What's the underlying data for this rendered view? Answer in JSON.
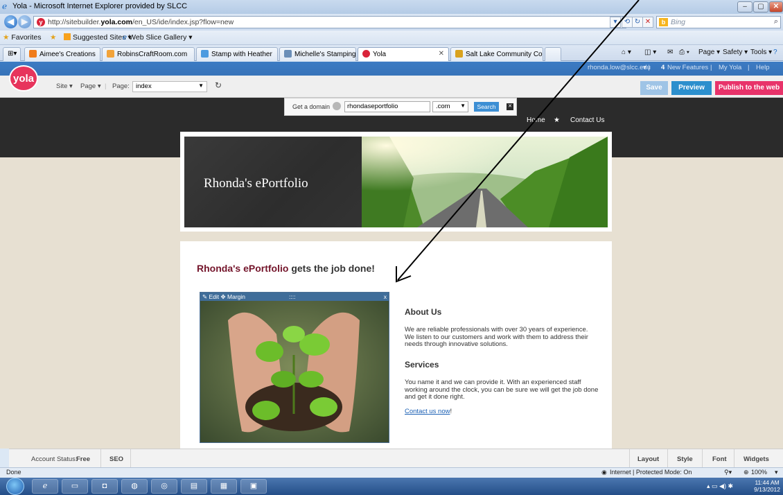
{
  "window": {
    "title": "Yola - Microsoft Internet Explorer provided by SLCC",
    "url_prefix": "http://sitebuilder.",
    "url_domain": "yola.com",
    "url_rest": "/en_US/ide/index.jsp?flow=new",
    "search_placeholder": "Bing"
  },
  "favorites_bar": {
    "favorites": "Favorites",
    "suggested": "Suggested Sites ▾",
    "web_slice": "Web Slice Gallery ▾"
  },
  "tabs": [
    {
      "label": "Aimee's Creations",
      "color": "#f07c1c"
    },
    {
      "label": "RobinsCraftRoom.com",
      "color": "#f2a33a"
    },
    {
      "label": "Stamp with Heather",
      "color": "#4d9be0"
    },
    {
      "label": "Michelle's Stamping Blog",
      "color": "#6b8fb8"
    },
    {
      "label": "Yola",
      "color": "#d9243a"
    },
    {
      "label": "Salt Lake Community Coll...",
      "color": "#d9a21e"
    }
  ],
  "ie_tools": {
    "page": "Page ▾",
    "safety": "Safety ▾",
    "tools": "Tools ▾"
  },
  "yola": {
    "logo": "yola",
    "user": "rhonda.low@slcc.edu",
    "new_features_count": "4",
    "new_features": "New Features",
    "my_yola": "My Yola",
    "help": "Help",
    "site_menu": "Site ▾",
    "page_menu": "Page ▾",
    "page_label": "Page:",
    "page_value": "index",
    "save": "Save",
    "preview": "Preview",
    "publish": "Publish to the web"
  },
  "domain_bar": {
    "label": "Get a domain",
    "value": "rhondaseportfolio",
    "tld": ".com",
    "search": "Search"
  },
  "site_nav": {
    "home": "Home",
    "star": "★",
    "contact": "Contact Us"
  },
  "banner": {
    "title": "Rhonda's ePortfolio"
  },
  "content": {
    "heading_highlight": "Rhonda's ePortfolio",
    "heading_rest": " gets the job done!",
    "image_toolbar_edit": "Edit",
    "image_toolbar_margin": "Margin",
    "image_toolbar_dots": "::::",
    "image_toolbar_close": "x",
    "about_heading": "About Us",
    "about_text": "We are reliable professionals with over 30 years of experience. We listen to our customers and work with them to address their needs through innovative solutions.",
    "services_heading": "Services",
    "services_text": "You name it and we can provide it. With an experienced staff working around the clock, you can be sure we will get the job done and get it done right.",
    "contact_link": "Contact us now",
    "contact_suffix": "!"
  },
  "bottom_bar": {
    "account_label": "Account Status:",
    "account_value": "Free",
    "seo": "SEO",
    "layout": "Layout",
    "style": "Style",
    "font": "Font",
    "widgets": "Widgets"
  },
  "status_bar": {
    "left": "Done",
    "zone": "Internet | Protected Mode: On",
    "zoom": "100%"
  },
  "taskbar": {
    "time": "11:44 AM",
    "date": "9/13/2012"
  },
  "colors": {
    "yola_blue": "#3c7bc3",
    "publish_pink": "#e8336a",
    "preview_blue": "#2c8fcd",
    "heading_maroon": "#74152b"
  }
}
